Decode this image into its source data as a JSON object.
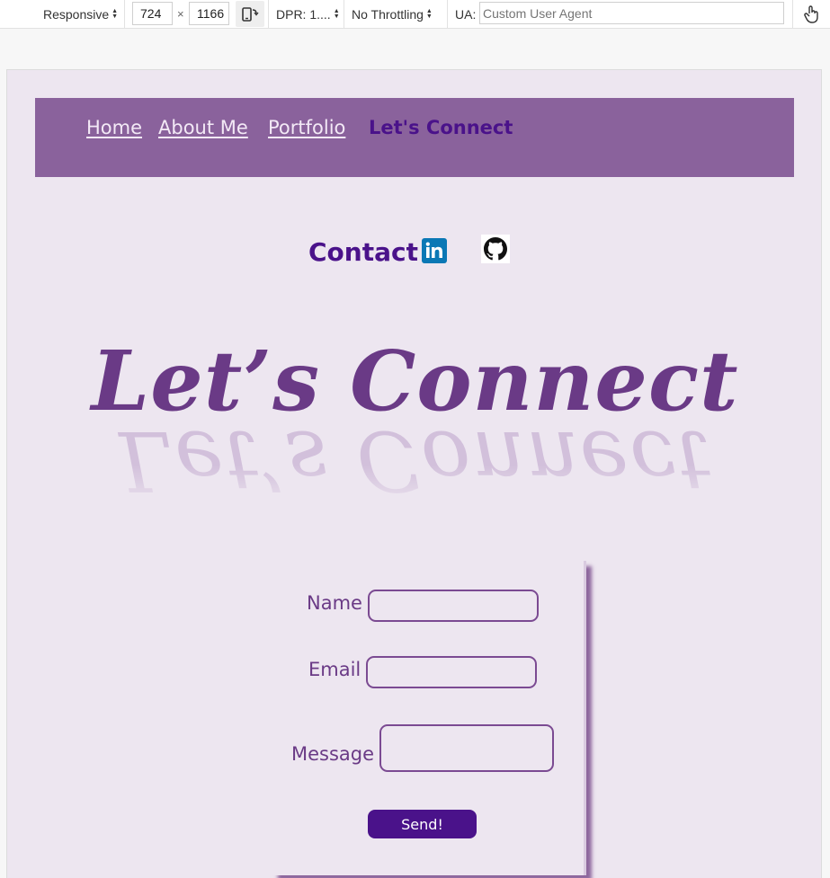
{
  "devtools": {
    "device_mode": "Responsive",
    "width_value": "724",
    "times_symbol": "×",
    "height_value": "1166",
    "dpr_label": "DPR: 1....",
    "throttling": "No Throttling",
    "ua_label": "UA:",
    "ua_placeholder": "Custom User Agent"
  },
  "nav": {
    "items": [
      {
        "label": "Home",
        "active": false
      },
      {
        "label": "About Me",
        "active": false
      },
      {
        "label": "Portfolio",
        "active": false
      },
      {
        "label": "Let's Connect",
        "active": true
      }
    ]
  },
  "contact": {
    "heading": "Contact",
    "linkedin_label": "in",
    "icons": [
      "linkedin-icon",
      "github-icon"
    ]
  },
  "hero": {
    "title": "Let’s Connect"
  },
  "form": {
    "name_label": "Name",
    "name_value": "",
    "email_label": "Email",
    "email_value": "",
    "message_label": "Message",
    "message_value": "",
    "submit_label": "Send!"
  },
  "colors": {
    "page_bg": "#ede6f0",
    "nav_bg": "#8a629c",
    "accent": "#4a128a",
    "text_purple": "#6a3a86",
    "linkedin": "#0a78b5"
  }
}
